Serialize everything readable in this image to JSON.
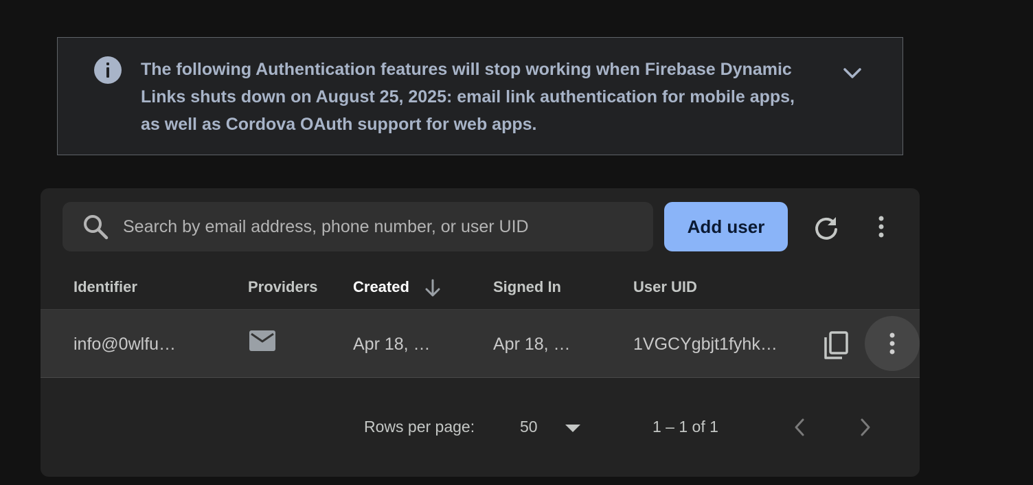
{
  "notice": {
    "icon": "info-icon",
    "message": "The following Authentication features will stop working when Firebase Dynamic Links shuts down on August 25, 2025: email link authentication for mobile apps, as well as Cordova OAuth support for web apps.",
    "expand_icon": "chevron-down-icon"
  },
  "search": {
    "icon": "search-icon",
    "placeholder": "Search by email address, phone number, or user UID",
    "value": ""
  },
  "toolbar": {
    "add_user_label": "Add user",
    "refresh_icon": "refresh-icon",
    "more_icon": "more-vert-icon"
  },
  "table": {
    "headers": {
      "identifier": "Identifier",
      "providers": "Providers",
      "created": "Created",
      "signed_in": "Signed In",
      "user_uid": "User UID"
    },
    "sort_column": "created",
    "sort_direction": "descending",
    "rows": [
      {
        "identifier": "info@0wlfu…",
        "provider_icon": "mail-icon",
        "created": "Apr 18, …",
        "signed_in": "Apr 18, …",
        "user_uid": "1VGCYgbjt1fyhk…"
      }
    ]
  },
  "pagination": {
    "rows_per_page_label": "Rows per page:",
    "rows_per_page_value": "50",
    "range_label": "1 – 1 of 1"
  },
  "colors": {
    "background": "#121212",
    "card": "#232323",
    "accent": "#8ab4f8",
    "notice_text": "#a8b4c8"
  }
}
